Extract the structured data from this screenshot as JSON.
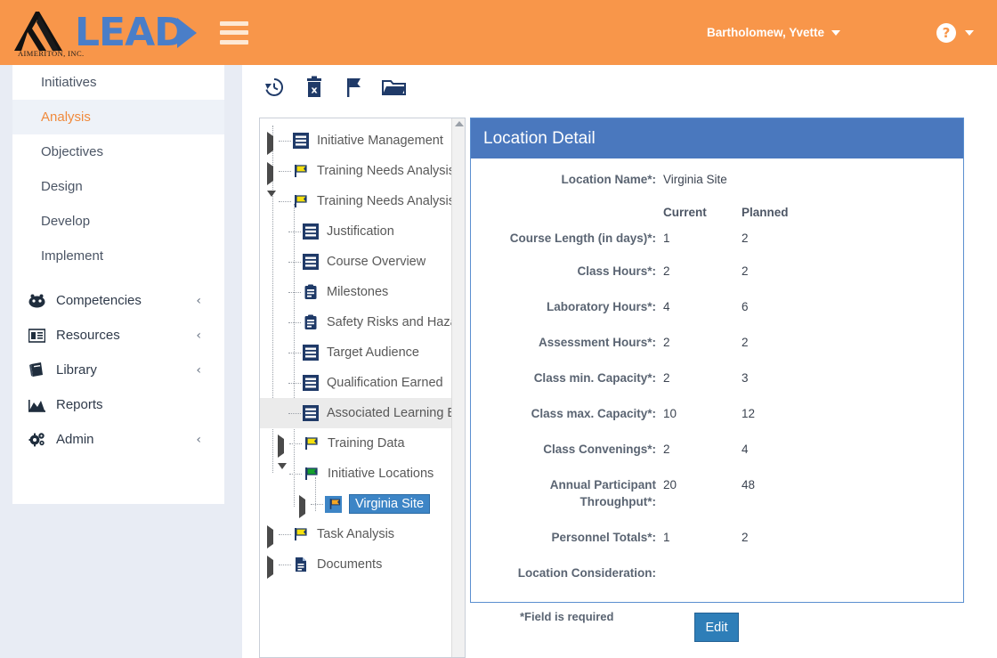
{
  "colors": {
    "header_orange": "#f8964a",
    "brand_blue": "#4a7ec8",
    "panel_blue": "#4a78be",
    "button_blue": "#2e7eb8",
    "tree_select_blue": "#3d85c6",
    "page_bg": "#e8ecf4",
    "active_nav_text": "#f08a3c"
  },
  "header": {
    "logo_text": "LEAD",
    "logo_subtitle": "AIMERITON, INC.",
    "hamburger_icon": "hamburger-menu-icon",
    "user_name": "Bartholomew, Yvette",
    "user_caret_icon": "caret-down-icon",
    "help_icon": "question-mark-icon",
    "help_caret_icon": "caret-down-icon"
  },
  "sidebar": {
    "items": [
      {
        "label": "Initiatives",
        "icon": "",
        "active": false,
        "chevron": false
      },
      {
        "label": "Analysis",
        "icon": "",
        "active": true,
        "chevron": false
      },
      {
        "label": "Objectives",
        "icon": "",
        "active": false,
        "chevron": false
      },
      {
        "label": "Design",
        "icon": "",
        "active": false,
        "chevron": false
      },
      {
        "label": "Develop",
        "icon": "",
        "active": false,
        "chevron": false
      },
      {
        "label": "Implement",
        "icon": "",
        "active": false,
        "chevron": false
      },
      {
        "label": "Competencies",
        "icon": "competencies-icon",
        "active": false,
        "chevron": true
      },
      {
        "label": "Resources",
        "icon": "resources-icon",
        "active": false,
        "chevron": true
      },
      {
        "label": "Library",
        "icon": "library-icon",
        "active": false,
        "chevron": true
      },
      {
        "label": "Reports",
        "icon": "reports-icon",
        "active": false,
        "chevron": false
      },
      {
        "label": "Admin",
        "icon": "admin-gears-icon",
        "active": false,
        "chevron": true
      }
    ],
    "chevron_glyph": "‹"
  },
  "toolbar": {
    "buttons": [
      {
        "name": "history-icon",
        "title": "History"
      },
      {
        "name": "delete-trash-icon",
        "title": "Delete"
      },
      {
        "name": "flag-icon",
        "title": "Flag"
      },
      {
        "name": "open-folder-icon",
        "title": "Open Folder"
      }
    ]
  },
  "tree": {
    "scroll_up_icon": "scroll-up-arrow-icon",
    "nodes": [
      {
        "label": "Initiative Management",
        "icon": "document-lines-icon",
        "indent": 0,
        "expander": "closed",
        "state": "normal"
      },
      {
        "label": "Training Needs Analysis ((",
        "icon": "flag-yellow-icon",
        "indent": 0,
        "expander": "closed",
        "state": "normal"
      },
      {
        "label": "Training Needs Analysis",
        "icon": "flag-yellow-icon",
        "indent": 0,
        "expander": "open",
        "state": "normal"
      },
      {
        "label": "Justification",
        "icon": "document-lines-icon",
        "indent": 1,
        "expander": "none",
        "state": "normal"
      },
      {
        "label": "Course Overview",
        "icon": "document-lines-icon",
        "indent": 1,
        "expander": "none",
        "state": "normal"
      },
      {
        "label": "Milestones",
        "icon": "clipboard-icon",
        "indent": 1,
        "expander": "none",
        "state": "normal"
      },
      {
        "label": "Safety Risks and Haza",
        "icon": "clipboard-icon",
        "indent": 1,
        "expander": "none",
        "state": "normal"
      },
      {
        "label": "Target Audience",
        "icon": "document-lines-icon",
        "indent": 1,
        "expander": "none",
        "state": "normal"
      },
      {
        "label": "Qualification Earned",
        "icon": "document-lines-icon",
        "indent": 1,
        "expander": "none",
        "state": "normal"
      },
      {
        "label": "Associated Learning E",
        "icon": "document-lines-icon",
        "indent": 1,
        "expander": "none",
        "state": "highlight"
      },
      {
        "label": "Training Data",
        "icon": "flag-yellow-icon",
        "indent": 1,
        "expander": "closed",
        "state": "normal"
      },
      {
        "label": "Initiative Locations",
        "icon": "flag-green-icon",
        "indent": 1,
        "expander": "open",
        "state": "normal"
      },
      {
        "label": "Virginia Site",
        "icon": "flag-orange-icon",
        "indent": 2,
        "expander": "closed",
        "state": "selected"
      },
      {
        "label": "Task Analysis",
        "icon": "flag-yellow-icon",
        "indent": 0,
        "expander": "closed",
        "state": "normal"
      },
      {
        "label": "Documents",
        "icon": "page-icon",
        "indent": 0,
        "expander": "closed",
        "state": "normal"
      }
    ]
  },
  "detail": {
    "title": "Location Detail",
    "column_headers": {
      "current": "Current",
      "planned": "Planned"
    },
    "location_name_label": "Location Name*:",
    "location_name_value": "Virginia Site",
    "fields": [
      {
        "label": "Course Length (in days)*:",
        "current": "1",
        "planned": "2"
      },
      {
        "label": "Class Hours*:",
        "current": "2",
        "planned": "2"
      },
      {
        "label": "Laboratory Hours*:",
        "current": "4",
        "planned": "6"
      },
      {
        "label": "Assessment Hours*:",
        "current": "2",
        "planned": "2"
      },
      {
        "label": "Class min. Capacity*:",
        "current": "2",
        "planned": "3"
      },
      {
        "label": "Class max. Capacity*:",
        "current": "10",
        "planned": "12"
      },
      {
        "label": "Class Convenings*:",
        "current": "2",
        "planned": "4"
      },
      {
        "label": "Annual Participant Throughput*:",
        "current": "20",
        "planned": "48"
      },
      {
        "label": "Personnel Totals*:",
        "current": "1",
        "planned": "2"
      },
      {
        "label": "Location Consideration:",
        "current": "",
        "planned": ""
      }
    ],
    "required_note": "*Field is required",
    "edit_button": "Edit"
  }
}
